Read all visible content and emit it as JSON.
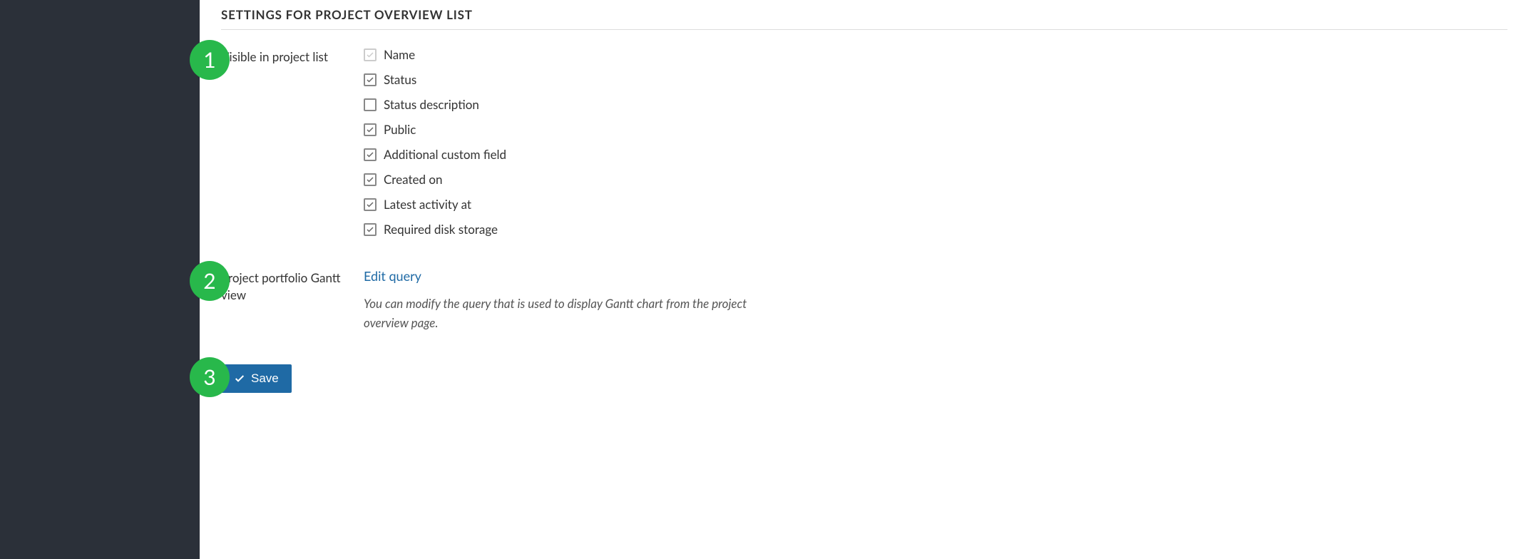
{
  "section_title": "SETTINGS FOR PROJECT OVERVIEW LIST",
  "badges": {
    "one": "1",
    "two": "2",
    "three": "3"
  },
  "row1": {
    "label": "Visible in project list",
    "options": [
      {
        "label": "Name",
        "checked": true,
        "disabled": true
      },
      {
        "label": "Status",
        "checked": true,
        "disabled": false
      },
      {
        "label": "Status description",
        "checked": false,
        "disabled": false
      },
      {
        "label": "Public",
        "checked": true,
        "disabled": false
      },
      {
        "label": "Additional custom field",
        "checked": true,
        "disabled": false
      },
      {
        "label": "Created on",
        "checked": true,
        "disabled": false
      },
      {
        "label": "Latest activity at",
        "checked": true,
        "disabled": false
      },
      {
        "label": "Required disk storage",
        "checked": true,
        "disabled": false
      }
    ]
  },
  "row2": {
    "label": "Project portfolio Gantt view",
    "link": "Edit query",
    "help": "You can modify the query that is used to display Gantt chart from the project overview page."
  },
  "save_label": "Save"
}
